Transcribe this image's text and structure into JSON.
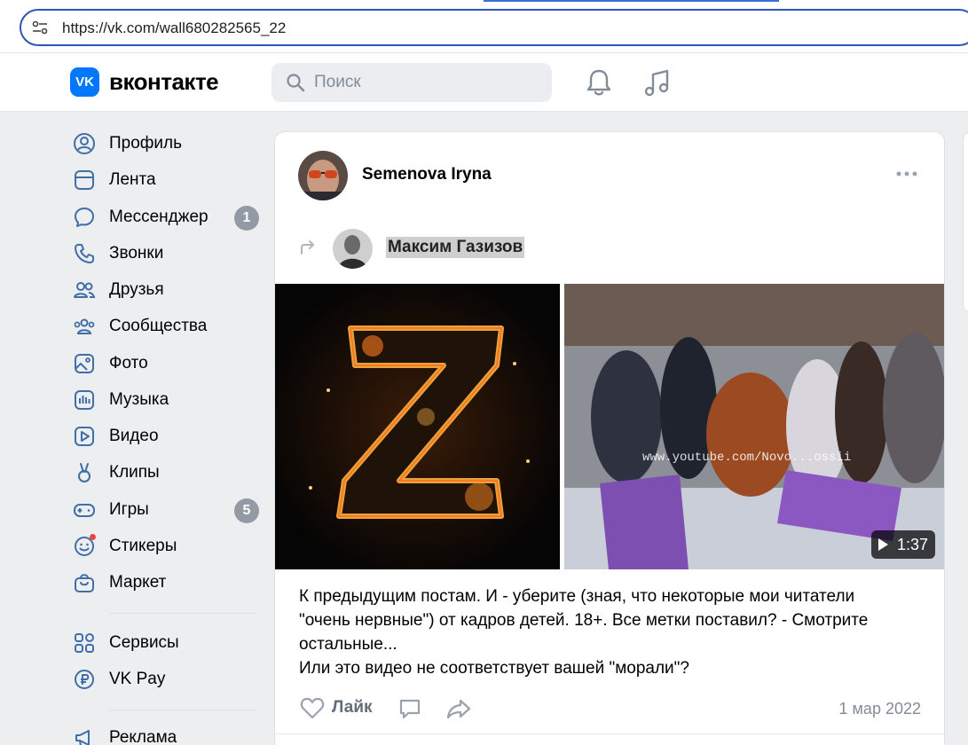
{
  "browser": {
    "url": "https://vk.com/wall680282565_22"
  },
  "header": {
    "logo_text": "VK",
    "brand": "вконтакте",
    "search_placeholder": "Поиск"
  },
  "sidebar": {
    "items": [
      {
        "label": "Профиль",
        "icon": "profile-icon"
      },
      {
        "label": "Лента",
        "icon": "feed-icon"
      },
      {
        "label": "Мессенджер",
        "icon": "messenger-icon",
        "badge": "1"
      },
      {
        "label": "Звонки",
        "icon": "phone-icon"
      },
      {
        "label": "Друзья",
        "icon": "friends-icon"
      },
      {
        "label": "Сообщества",
        "icon": "communities-icon"
      },
      {
        "label": "Фото",
        "icon": "photo-icon"
      },
      {
        "label": "Музыка",
        "icon": "music-icon"
      },
      {
        "label": "Видео",
        "icon": "video-icon"
      },
      {
        "label": "Клипы",
        "icon": "clips-icon"
      },
      {
        "label": "Игры",
        "icon": "games-icon",
        "badge": "5"
      },
      {
        "label": "Стикеры",
        "icon": "stickers-icon"
      },
      {
        "label": "Маркет",
        "icon": "market-icon"
      },
      {
        "label": "Сервисы",
        "icon": "services-icon"
      },
      {
        "label": "VK Pay",
        "icon": "vkpay-icon"
      },
      {
        "label": "Реклама",
        "icon": "ads-icon"
      }
    ]
  },
  "post": {
    "author": "Semenova Iryna",
    "repost_author": "Максим Газизов",
    "video_duration": "1:37",
    "video_watermark": "www.youtube.com/Novo...ossii",
    "text_lines": [
      "К предыдущим постам. И - уберите (зная, что некоторые мои читатели",
      "\"очень нервные\") от кадров детей. 18+. Все метки поставил? - Смотрите",
      "остальные...",
      "Или это видео не соответствует вашей \"морали\"?"
    ],
    "like_label": "Лайк",
    "date": "1 мар 2022"
  },
  "colors": {
    "vk_blue": "#0077ff",
    "background": "#edeef0",
    "badge": "#939aa3",
    "icon_blue": "#2a5885"
  }
}
